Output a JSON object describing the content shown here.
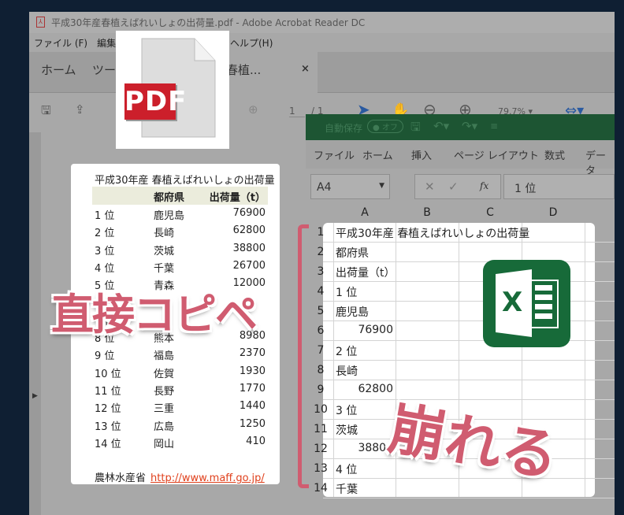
{
  "acrobat": {
    "title": "平成30年産春植えばれいしょの出荷量.pdf - Adobe Acrobat Reader DC",
    "menu": [
      "ファイル (F)",
      "編集 (E)",
      "ヘルプ(H)"
    ],
    "tabs": [
      "ホーム",
      "ツール",
      "春植..."
    ],
    "tab_close": "×",
    "toolbar": {
      "page_current": "1",
      "page_total": "/ 1",
      "zoom": "79.7%"
    }
  },
  "pdf_page": {
    "title": "平成30年産 春植えばれいしょの出荷量",
    "headers": [
      "",
      "都府県",
      "出荷量（t）"
    ],
    "rows": [
      [
        "1 位",
        "鹿児島",
        "76900"
      ],
      [
        "2 位",
        "長崎",
        "62800"
      ],
      [
        "3 位",
        "茨城",
        "38800"
      ],
      [
        "4 位",
        "千葉",
        "26700"
      ],
      [
        "5 位",
        "青森",
        "12000"
      ],
      [
        "6 位",
        "",
        ""
      ],
      [
        "7 位",
        "",
        ""
      ],
      [
        "8 位",
        "熊本",
        "8980"
      ],
      [
        "9 位",
        "福島",
        "2370"
      ],
      [
        "10 位",
        "佐賀",
        "1930"
      ],
      [
        "11 位",
        "長野",
        "1770"
      ],
      [
        "12 位",
        "三重",
        "1440"
      ],
      [
        "13 位",
        "広島",
        "1250"
      ],
      [
        "14 位",
        "岡山",
        "410"
      ]
    ],
    "source": "農林水産省",
    "link": "http://www.maff.go.jp/"
  },
  "pdf_icon": {
    "label": "PDF",
    "color": "#cc1f2b"
  },
  "excel": {
    "autosave": "自動保存",
    "autosave_state": "オフ",
    "ribbon": [
      "ファイル",
      "ホーム",
      "挿入",
      "ページ レイアウト",
      "数式",
      "データ"
    ],
    "name_box": "A4",
    "fx": "fx",
    "formula": "1 位",
    "columns": [
      "A",
      "B",
      "C",
      "D"
    ],
    "rows": [
      [
        "1",
        "平成30年産 春植えばれいしょの出荷量"
      ],
      [
        "2",
        "都府県"
      ],
      [
        "3",
        "出荷量（t）"
      ],
      [
        "4",
        "1 位"
      ],
      [
        "5",
        "鹿児島"
      ],
      [
        "6",
        "76900"
      ],
      [
        "7",
        "2 位"
      ],
      [
        "8",
        "長崎"
      ],
      [
        "9",
        "62800"
      ],
      [
        "10",
        "3 位"
      ],
      [
        "11",
        "茨城"
      ],
      [
        "12",
        "38800"
      ],
      [
        "13",
        "4 位"
      ],
      [
        "14",
        "千葉"
      ]
    ],
    "icon_letter": "X",
    "brand_color": "#176a39"
  },
  "overlay": {
    "copy_label": "直接コピペ",
    "broken_label": "崩れる",
    "accent": "#d05c70"
  }
}
